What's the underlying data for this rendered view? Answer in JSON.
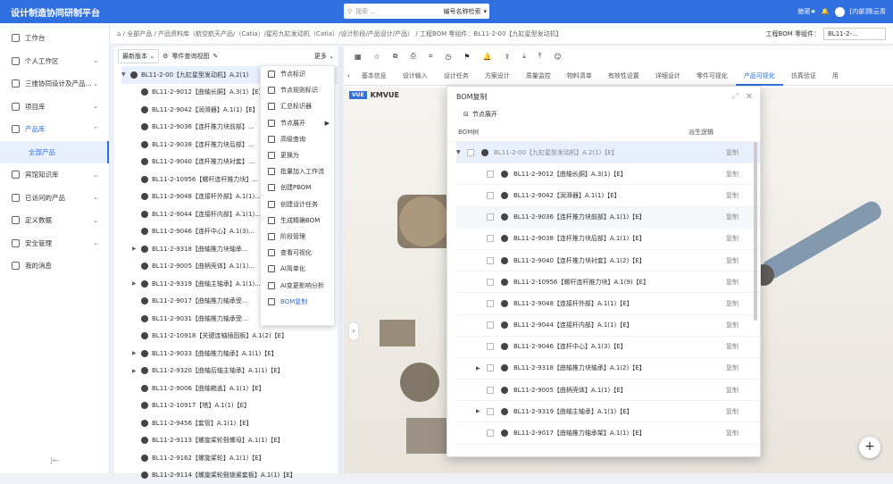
{
  "app": {
    "title": "设计制造协同研制平台",
    "user": "[内部]陈云青",
    "mode": "编号名称检索",
    "search_placeholder": "搜索 ...",
    "status_text": "绝密★"
  },
  "sidebar": {
    "items": [
      {
        "label": "工作台",
        "chev": ""
      },
      {
        "label": "个人工作区",
        "chev": "⌄"
      },
      {
        "label": "三维协同设计及产品...",
        "chev": "⌄"
      },
      {
        "label": "项目库",
        "chev": "⌄"
      },
      {
        "label": "产品库",
        "chev": "⌃"
      }
    ],
    "sub_item": "全部产品",
    "items2": [
      {
        "label": "宾馆知识库",
        "chev": "⌄"
      },
      {
        "label": "已访问的产品",
        "chev": "⌄"
      },
      {
        "label": "定义数据",
        "chev": "⌄"
      },
      {
        "label": "安全管理",
        "chev": "⌄"
      },
      {
        "label": "我的消息",
        "chev": ""
      }
    ],
    "collapse": "|←"
  },
  "breadcrumb": {
    "path": "⌂  /  全部产品  /  产品资料库（航空航天产品/（Catia）/星形九缸发动机（Catia）/设计阶段/产品设计/产品）  /  工程BOM 零组件：BL11-2-00【九缸星型发动机】",
    "ctx_label": "工程BOM 零组件：",
    "ctx_value": "BL11-2-..."
  },
  "tree": {
    "version_select": "最新版本 ⌄",
    "menu_btn": "零件查询视图",
    "more": "更多 ⌄",
    "rows": [
      {
        "t": "▼",
        "label": "BL11-2-00【九缸星型发动机】A.2(1)",
        "top": true
      },
      {
        "t": "",
        "label": "BL11-2-9012【曲轴长胴】A.3(1)【E】"
      },
      {
        "t": "",
        "label": "BL11-2-9042【润滑器】A.1(1)【E】"
      },
      {
        "t": "",
        "label": "BL11-2-9036【连杆推力块前部】..."
      },
      {
        "t": "",
        "label": "BL11-2-9038【连杆推力块后部】..."
      },
      {
        "t": "",
        "label": "BL11-2-9040【连杆推力块衬套】..."
      },
      {
        "t": "",
        "label": "BL11-2-10956【螺杆连杆推力块】..."
      },
      {
        "t": "",
        "label": "BL11-2-9048【连接杆外部】A.1(1)..."
      },
      {
        "t": "",
        "label": "BL11-2-9044【连接杆内部】A.1(1)..."
      },
      {
        "t": "",
        "label": "BL11-2-9046【连杆中心】A.1(3)..."
      },
      {
        "t": "▶",
        "label": "BL11-2-9318【曲轴推力块轴承..."
      },
      {
        "t": "",
        "label": "BL11-2-9005【曲柄壳体】A.1(1)..."
      },
      {
        "t": "▶",
        "label": "BL11-2-9319【曲轴主轴承】A.1(1)..."
      },
      {
        "t": "",
        "label": "BL11-2-9017【曲轴推力轴承受..."
      },
      {
        "t": "",
        "label": "BL11-2-9031【曲轴推力轴承受..."
      },
      {
        "t": "",
        "label": "BL11-2-10918【关键连轴插固板】A.1(2)【E】"
      },
      {
        "t": "▶",
        "label": "BL11-2-9033【曲轴推力轴承】A.1(1)【E】"
      },
      {
        "t": "▶",
        "label": "BL11-2-9320【曲轴后轴主轴承】A.1(1)【E】"
      },
      {
        "t": "",
        "label": "BL11-2-9006【曲轴箱盖】A.1(1)【E】"
      },
      {
        "t": "",
        "label": "BL11-2-10917【塔】A.1(1)【E】"
      },
      {
        "t": "",
        "label": "BL11-2-9456【套管】A.1(1)【E】"
      },
      {
        "t": "",
        "label": "BL11-2-9113【螺旋桨轮毂螺母】A.1(1)【E】"
      },
      {
        "t": "",
        "label": "BL11-2-9162【螺旋桨轮】A.1(1)【E】"
      },
      {
        "t": "",
        "label": "BL11-2-9114【螺旋桨轮毂锁紧套板】A.1(1)【E】"
      }
    ]
  },
  "menu": {
    "items": [
      {
        "label": "节点标识",
        "arr": ""
      },
      {
        "label": "节点规则标识",
        "arr": ""
      },
      {
        "label": "汇总标识器",
        "arr": ""
      },
      {
        "label": "节点展开",
        "arr": "▶"
      },
      {
        "label": "高级查询",
        "arr": ""
      },
      {
        "label": "更换为",
        "arr": ""
      },
      {
        "label": "批量加入工作流",
        "arr": ""
      },
      {
        "label": "创建PBOM",
        "arr": ""
      },
      {
        "label": "创建设计任务",
        "arr": ""
      },
      {
        "label": "生成精确BOM",
        "arr": ""
      },
      {
        "label": "阶段管理",
        "arr": ""
      },
      {
        "label": "查看可视化",
        "arr": ""
      },
      {
        "label": "AI简单化",
        "arr": ""
      },
      {
        "label": "AI变更影响分析",
        "arr": ""
      },
      {
        "label": "BOM复制",
        "arr": ""
      }
    ]
  },
  "right": {
    "tabs": [
      "基本信息",
      "设计输入",
      "设计任务",
      "方案设计",
      "质量监控",
      "物料清单",
      "有效性设置",
      "详细设计",
      "零件可视化",
      "产品可视化",
      "仿真验证",
      "用"
    ],
    "active_tab": 9,
    "viewer_title": "KMVUE",
    "viewer_logo": "VUE"
  },
  "dialog": {
    "title": "BOM复制",
    "expand_btn": "节点展开",
    "col_tree": "BOM树",
    "col_logic": "派生逻辑",
    "rows": [
      {
        "t": "▼",
        "label": "BL11-2-00【九缸星型发动机】A.2(1)【E】",
        "copy": "复制",
        "top": true
      },
      {
        "t": "",
        "label": "BL11-2-9012【曲轴长胴】A.3(1)【E】",
        "copy": "复制"
      },
      {
        "t": "",
        "label": "BL11-2-9042【润滑器】A.1(1)【E】",
        "copy": "复制"
      },
      {
        "t": "",
        "label": "BL11-2-9036【连杆推力块前部】A.1(1)【E】",
        "copy": "复制",
        "hi": true
      },
      {
        "t": "",
        "label": "BL11-2-9038【连杆推力块后部】A.1(1)【E】",
        "copy": "复制"
      },
      {
        "t": "",
        "label": "BL11-2-9040【连杆推力块衬套】A.1(2)【E】",
        "copy": "复制"
      },
      {
        "t": "",
        "label": "BL11-2-10956【螺杆连杆推力块】A.1(9)【E】",
        "copy": "复制"
      },
      {
        "t": "",
        "label": "BL11-2-9048【连接杆外部】A.1(1)【E】",
        "copy": "复制"
      },
      {
        "t": "",
        "label": "BL11-2-9044【连接杆内部】A.1(1)【E】",
        "copy": "复制"
      },
      {
        "t": "",
        "label": "BL11-2-9046【连杆中心】A.1(3)【E】",
        "copy": "复制"
      },
      {
        "t": "▶",
        "label": "BL11-2-9318【曲轴推力块轴承】A.1(2)【E】",
        "copy": "复制"
      },
      {
        "t": "",
        "label": "BL11-2-9005【曲柄壳体】A.1(1)【E】",
        "copy": "复制"
      },
      {
        "t": "▶",
        "label": "BL11-2-9319【曲轴主轴承】A.1(1)【E】",
        "copy": "复制"
      },
      {
        "t": "",
        "label": "BL11-2-9017【曲轴推力轴承架】A.1(1)【E】",
        "copy": "复制"
      }
    ]
  },
  "fab": "+",
  "pull": "›"
}
